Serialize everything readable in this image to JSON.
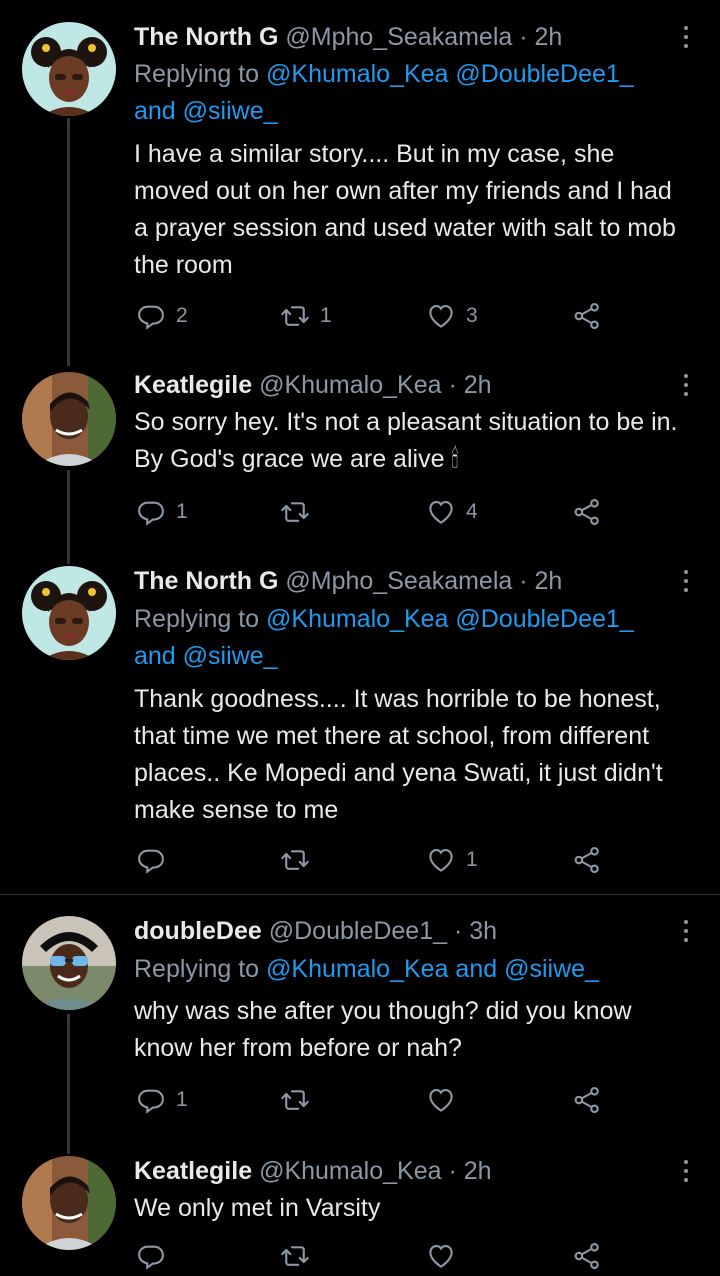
{
  "tweets": [
    {
      "name": "The North G",
      "handle": "@Mpho_Seakamela",
      "dot": "·",
      "time": "2h",
      "replying_prefix": "Replying to",
      "replying_line1": "@Khumalo_Kea @DoubleDee1_",
      "replying_and": "and",
      "replying_last": "@siiwe_",
      "text": "I have a similar story.... But in my case, she moved out on her own after my friends and I had a prayer session and used water with salt to mob the room",
      "replies": "2",
      "retweets": "1",
      "likes": "3"
    },
    {
      "name": "Keatlegile",
      "handle": "@Khumalo_Kea",
      "dot": "·",
      "time": "2h",
      "text": "So sorry hey. It's not a pleasant situation to be in. By God's grace we are alive 🕯",
      "replies": "1",
      "retweets": "",
      "likes": "4"
    },
    {
      "name": "The North G",
      "handle": "@Mpho_Seakamela",
      "dot": "·",
      "time": "2h",
      "replying_prefix": "Replying to",
      "replying_line1": "@Khumalo_Kea @DoubleDee1_",
      "replying_and": "and",
      "replying_last": "@siiwe_",
      "text": "Thank goodness.... It was horrible to be honest, that time we met there at school, from different places.. Ke Mopedi and yena Swati, it just didn't make sense to me",
      "replies": "",
      "retweets": "",
      "likes": "1"
    },
    {
      "name": "doubleDee",
      "handle": "@DoubleDee1_",
      "dot": "·",
      "time": "3h",
      "replying_prefix": "Replying to",
      "replying_m1": "@Khumalo_Kea",
      "replying_and": "and",
      "replying_m2": "@siiwe_",
      "text": "why was she after you though? did you know know her from before or nah?",
      "replies": "1",
      "retweets": "",
      "likes": ""
    },
    {
      "name": "Keatlegile",
      "handle": "@Khumalo_Kea",
      "dot": "·",
      "time": "2h",
      "text": "We only met in Varsity",
      "replies": "",
      "retweets": "",
      "likes": ""
    }
  ],
  "colors": {
    "background": "#000000",
    "text": "#e7e9ea",
    "muted": "#8b98a5",
    "link": "#1d9bf0",
    "divider": "#2f3336"
  },
  "icons": [
    "reply-icon",
    "retweet-icon",
    "like-icon",
    "share-icon",
    "more-icon"
  ]
}
